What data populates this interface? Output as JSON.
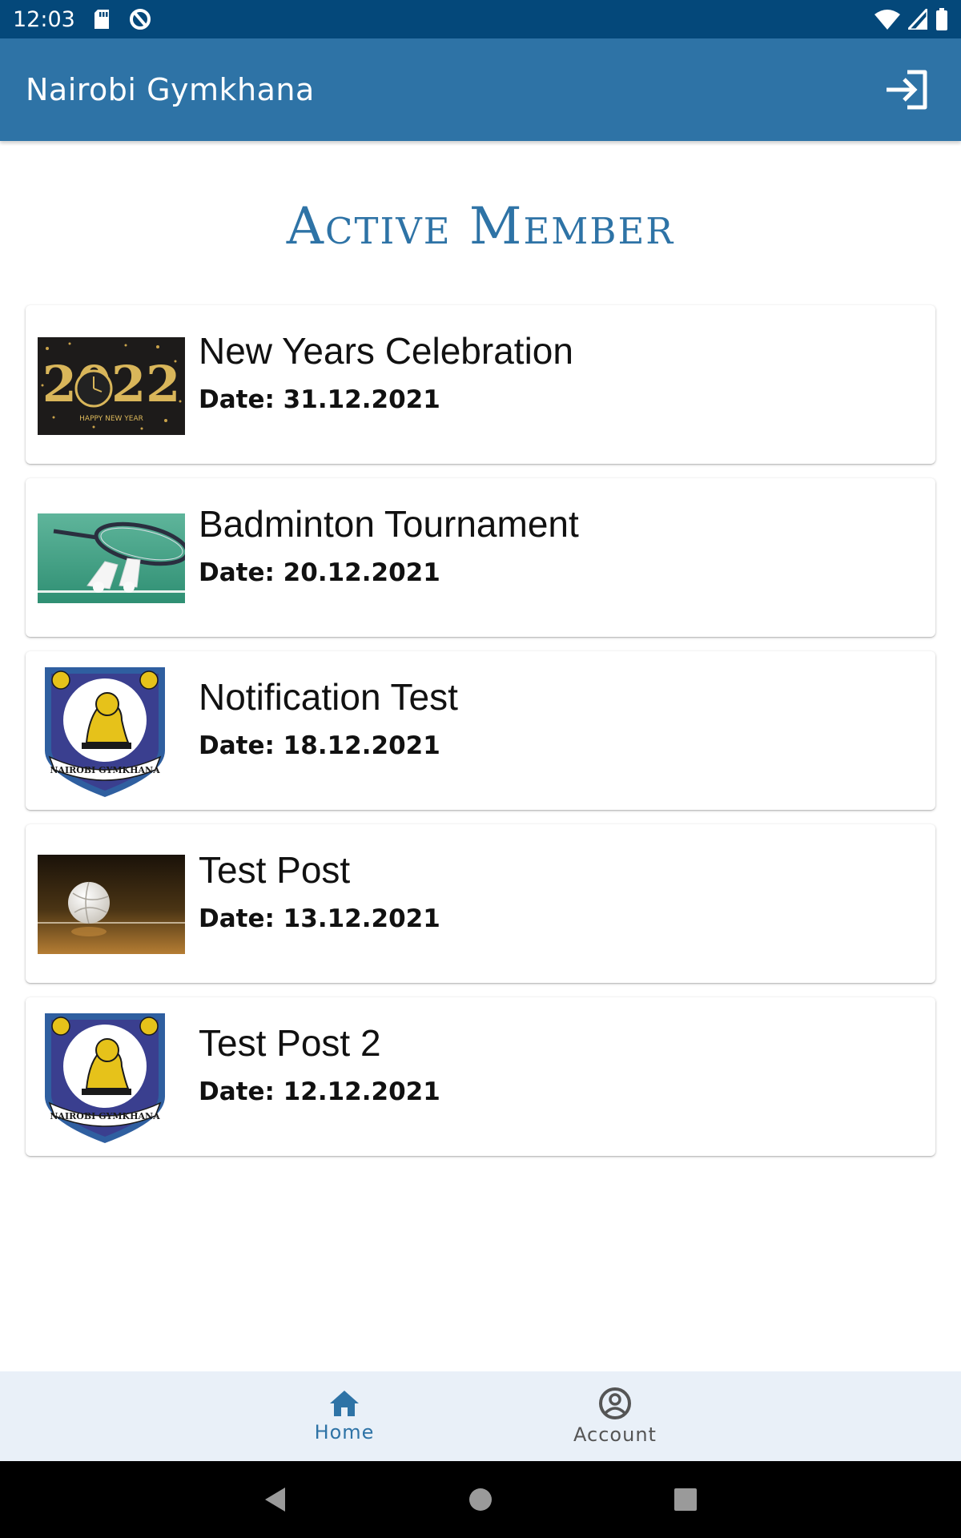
{
  "status_bar": {
    "time": "12:03",
    "icons": [
      "sd-card-icon",
      "data-saver-icon",
      "wifi-icon",
      "signal-icon",
      "battery-icon"
    ]
  },
  "app_bar": {
    "title": "Nairobi Gymkhana",
    "logout_icon": "login-arrow-icon"
  },
  "heading": "Active Member",
  "posts": [
    {
      "title": "New Years Celebration",
      "date": "Date: 31.12.2021",
      "image": "happy-new-year-2022"
    },
    {
      "title": "Badminton Tournament",
      "date": "Date: 20.12.2021",
      "image": "badminton-racket-shuttlecocks"
    },
    {
      "title": "Notification Test",
      "date": "Date: 18.12.2021",
      "image": "nairobi-gymkhana-crest",
      "crest_text": "NAIROBI GYMKHANA"
    },
    {
      "title": "Test Post",
      "date": "Date: 13.12.2021",
      "image": "volleyball-on-court"
    },
    {
      "title": "Test Post 2",
      "date": "Date: 12.12.2021",
      "image": "nairobi-gymkhana-crest",
      "crest_text": "NAIROBI GYMKHANA"
    }
  ],
  "thumb_text": {
    "year": "2022",
    "caption": "HAPPY NEW YEAR"
  },
  "bottom_nav": {
    "items": [
      {
        "label": "Home",
        "icon": "home-icon",
        "active": true
      },
      {
        "label": "Account",
        "icon": "account-circle-icon",
        "active": false
      }
    ]
  },
  "colors": {
    "status_bar": "#04487a",
    "primary": "#2e73a6",
    "bottom_nav_bg": "#e9f0f8",
    "nav_active": "#2e73a6",
    "nav_inactive": "#555555"
  }
}
